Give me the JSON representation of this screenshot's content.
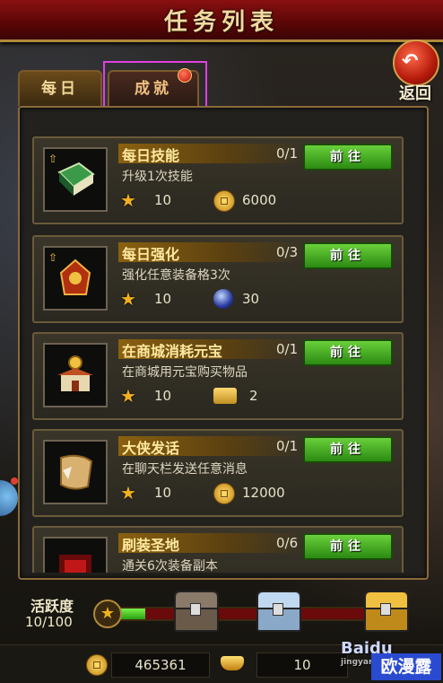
{
  "title": "任务列表",
  "back_label": "返回",
  "tabs": [
    {
      "label": "每日"
    },
    {
      "label": "成就"
    }
  ],
  "tasks": [
    {
      "name": "每日技能",
      "progress": "0/1",
      "desc": "升级1次技能",
      "reward1": "10",
      "reward2": "6000",
      "reward2_icon": "gold-coin-icon",
      "button": "前往",
      "icon": "skill-book-icon"
    },
    {
      "name": "每日强化",
      "progress": "0/3",
      "desc": "强化任意装备格3次",
      "reward1": "10",
      "reward2": "30",
      "reward2_icon": "gem-icon",
      "button": "前往",
      "icon": "armor-icon"
    },
    {
      "name": "在商城消耗元宝",
      "progress": "0/1",
      "desc": "在商城用元宝购买物品",
      "reward1": "10",
      "reward2": "2",
      "reward2_icon": "ticket-icon",
      "button": "前往",
      "icon": "shop-icon"
    },
    {
      "name": "大侠发话",
      "progress": "0/1",
      "desc": "在聊天栏发送任意消息",
      "reward1": "10",
      "reward2": "12000",
      "reward2_icon": "gold-coin-icon",
      "button": "前往",
      "icon": "scroll-icon"
    },
    {
      "name": "刷装圣地",
      "progress": "0/6",
      "desc": "通关6次装备副本",
      "button": "前往",
      "icon": "dungeon-gate-icon"
    }
  ],
  "activity": {
    "label": "活跃度",
    "value": "10/100",
    "fill_fraction": 0.1
  },
  "currency": {
    "gold": "465361",
    "ingot": "10"
  },
  "watermark": {
    "brand": "Baidu",
    "sub": "jingyan",
    "corner": "欧漫露"
  },
  "colors": {
    "title_bar": "#8a1010",
    "go_button": "#3aa81a",
    "highlight_box": "#e040e0"
  }
}
